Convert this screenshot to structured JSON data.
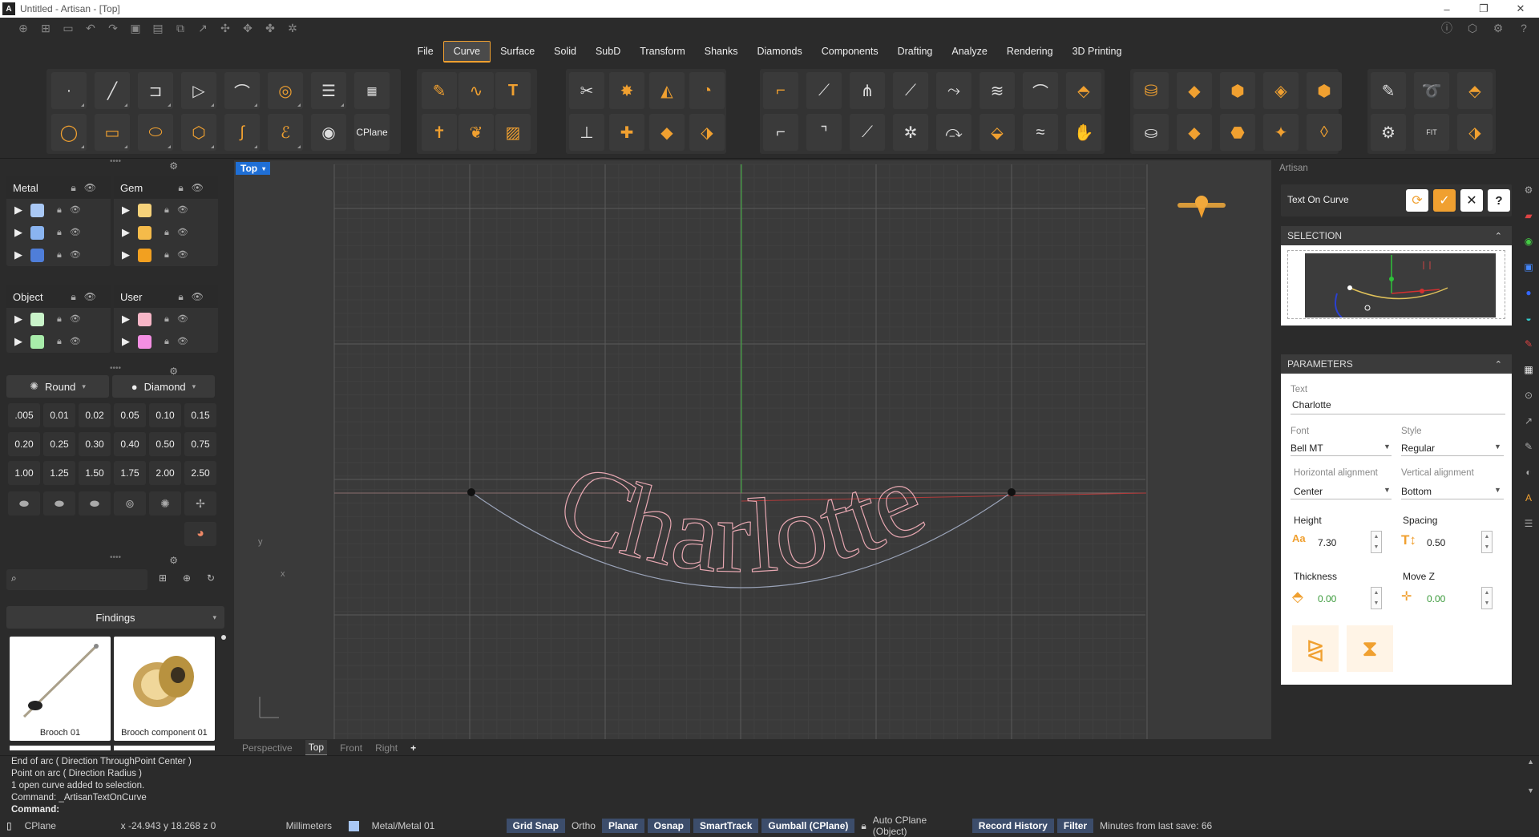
{
  "window": {
    "title": "Untitled - Artisan - [Top]",
    "logo": "A"
  },
  "menu": [
    "File",
    "Curve",
    "Surface",
    "Solid",
    "SubD",
    "Transform",
    "Shanks",
    "Diamonds",
    "Components",
    "Drafting",
    "Analyze",
    "Rendering",
    "3D Printing"
  ],
  "menu_active": "Curve",
  "toolbar": {
    "cplane_label": "CPlane"
  },
  "layers": {
    "groups": [
      {
        "name": "Metal",
        "colors": [
          "#a9c8f5",
          "#8ab4f0",
          "#4f7ed9"
        ]
      },
      {
        "name": "Gem",
        "colors": [
          "#f6d27a",
          "#f5bb4a",
          "#f2a020"
        ]
      },
      {
        "name": "Object",
        "colors": [
          "#c9f3c9",
          "#a8ecaa"
        ]
      },
      {
        "name": "User",
        "colors": [
          "#f7b6c7",
          "#f48fe3"
        ]
      }
    ]
  },
  "gems": {
    "shape": "Round",
    "cut": "Diamond",
    "sizes": [
      ".005",
      "0.01",
      "0.02",
      "0.05",
      "0.10",
      "0.15",
      "0.20",
      "0.25",
      "0.30",
      "0.40",
      "0.50",
      "0.75",
      "1.00",
      "1.25",
      "1.50",
      "1.75",
      "2.00",
      "2.50"
    ]
  },
  "library": {
    "search_placeholder": "",
    "category": "Findings",
    "items": [
      {
        "caption": "Brooch 01"
      },
      {
        "caption": "Brooch component 01"
      }
    ]
  },
  "viewport": {
    "label": "Top",
    "text": "Charlotte",
    "tabs": [
      "Perspective",
      "Top",
      "Front",
      "Right"
    ],
    "tab_active": "Top",
    "axis_y": "y",
    "axis_x": "x"
  },
  "panel": {
    "app": "Artisan",
    "tool": "Text On Curve",
    "selection_title": "SELECTION",
    "parameters_title": "PARAMETERS",
    "text_label": "Text",
    "text_value": "Charlotte",
    "font_label": "Font",
    "font_value": "Bell MT",
    "style_label": "Style",
    "style_value": "Regular",
    "halign_label": "Horizontal alignment",
    "halign_value": "Center",
    "valign_label": "Vertical alignment",
    "valign_value": "Bottom",
    "height_label": "Height",
    "height_value": "7.30",
    "spacing_label": "Spacing",
    "spacing_value": "0.50",
    "thickness_label": "Thickness",
    "thickness_value": "0.00",
    "movez_label": "Move Z",
    "movez_value": "0.00",
    "accent": "#f0a030"
  },
  "command": {
    "lines": [
      "End of arc ( Direction  ThroughPoint  Center )",
      "Point on arc ( Direction  Radius )",
      "1 open curve added to selection.",
      "Command: _ArtisanTextOnCurve"
    ],
    "prompt": "Command:"
  },
  "status": {
    "cplane": "CPlane",
    "coords": "x -24.943  y 18.268  z 0",
    "units": "Millimeters",
    "layer": "Metal/Metal 01",
    "grid_snap": "Grid Snap",
    "ortho": "Ortho",
    "planar": "Planar",
    "osnap": "Osnap",
    "smarttrack": "SmartTrack",
    "gumball": "Gumball (CPlane)",
    "autocplane": "Auto CPlane (Object)",
    "record_history": "Record History",
    "filter": "Filter",
    "save": "Minutes from last save: 66"
  }
}
